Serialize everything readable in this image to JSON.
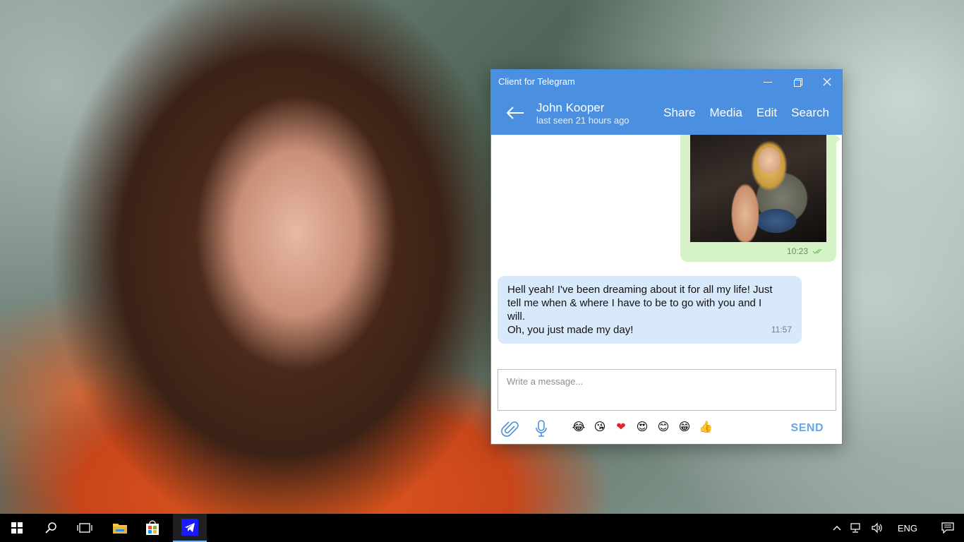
{
  "window": {
    "title": "Client for Telegram"
  },
  "header": {
    "contact_name": "John Kooper",
    "status": "last seen 21 hours ago",
    "actions": [
      "Share",
      "Media",
      "Edit",
      "Search"
    ]
  },
  "messages": {
    "outgoing_photo": {
      "time": "10:23"
    },
    "incoming": {
      "lines": [
        "Hell yeah! I've been dreaming about it for all my life! Just",
        "tell me when & where I have to be to go with you and I",
        "will.",
        "Oh, you just made my day!"
      ],
      "time": "11:57"
    }
  },
  "composer": {
    "placeholder": "Write a message..."
  },
  "toolbar": {
    "emojis": [
      "😂",
      "😘",
      "❤",
      "😍",
      "😊",
      "😁",
      "👍"
    ],
    "send_label": "SEND"
  },
  "taskbar": {
    "language": "ENG"
  },
  "colors": {
    "accent": "#4a8fe0",
    "outgoing_bubble": "#d5f3c7",
    "incoming_bubble": "#d8e9fb",
    "send": "#6aa6e8",
    "taskbar": "#000000"
  }
}
